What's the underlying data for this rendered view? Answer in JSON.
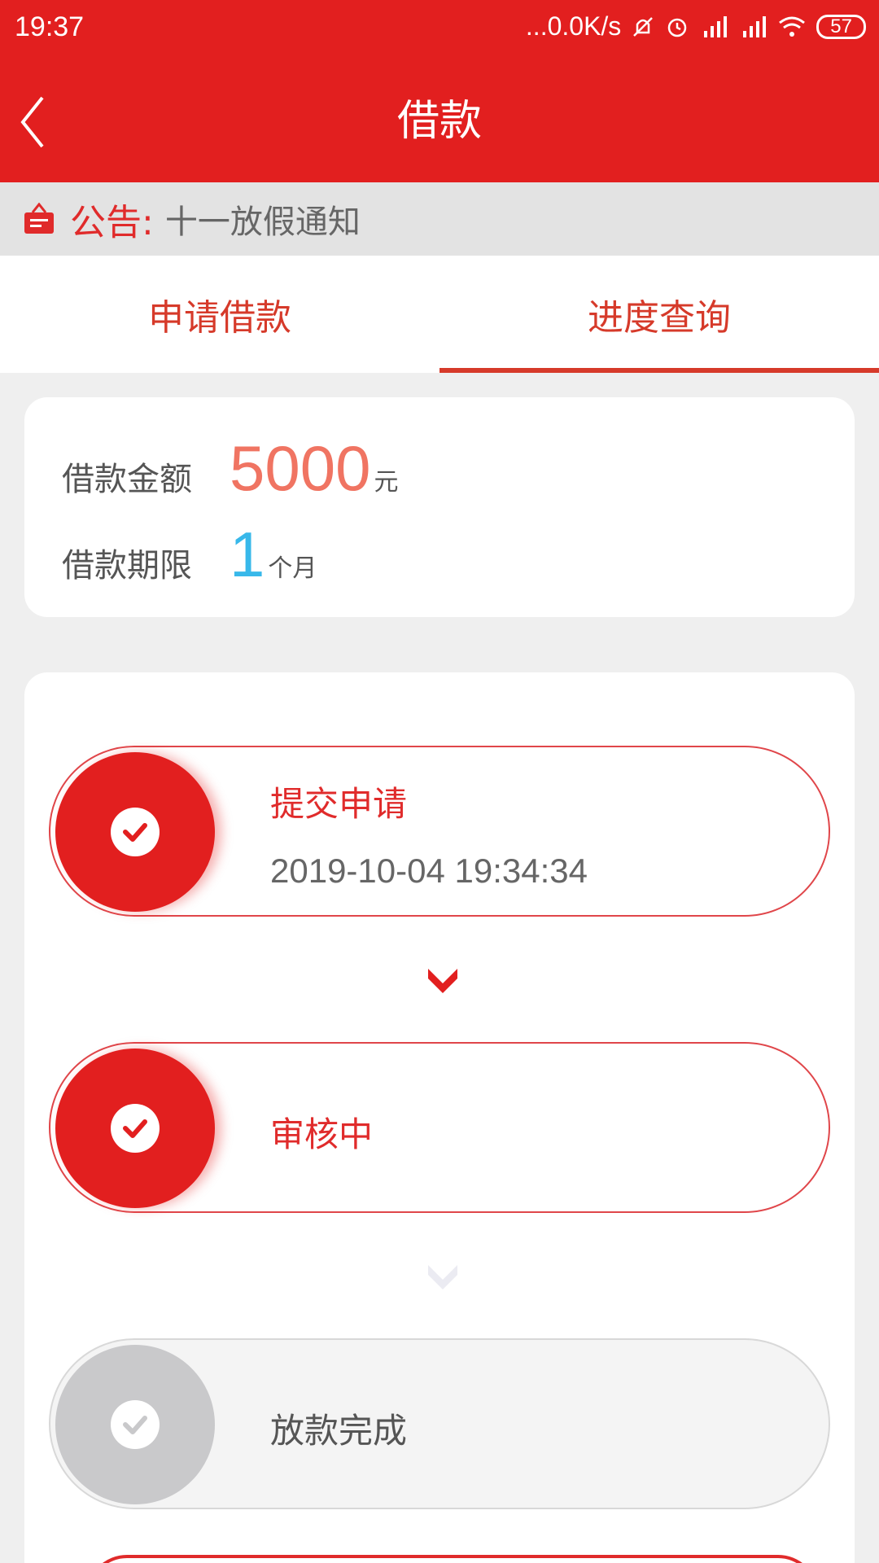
{
  "status_bar": {
    "time": "19:37",
    "network_speed": "...0.0K/s",
    "battery": "57",
    "icons": [
      "mute-icon",
      "alarm-icon",
      "hd-signal-icon",
      "signal-icon",
      "wifi-icon",
      "battery-icon"
    ]
  },
  "header": {
    "title": "借款",
    "back_icon": "chevron-left-icon"
  },
  "notice": {
    "label": "公告:",
    "text": "十一放假通知",
    "icon": "notice-board-icon"
  },
  "tabs": [
    {
      "label": "申请借款",
      "active": false
    },
    {
      "label": "进度查询",
      "active": true
    }
  ],
  "loan": {
    "amount_label": "借款金额",
    "amount": "5000",
    "amount_unit": "元",
    "term_label": "借款期限",
    "term": "1",
    "term_unit": "个月"
  },
  "progress": {
    "steps": [
      {
        "title": "提交申请",
        "time": "2019-10-04 19:34:34",
        "status": "done"
      },
      {
        "title": "审核中",
        "status": "done"
      },
      {
        "title": "放款完成",
        "status": "pending"
      }
    ]
  },
  "colors": {
    "primary": "#e21f1f",
    "accent_text": "#e02b2b",
    "amount": "#f07462",
    "term": "#38b8ea",
    "pending": "#c9c9cb"
  }
}
